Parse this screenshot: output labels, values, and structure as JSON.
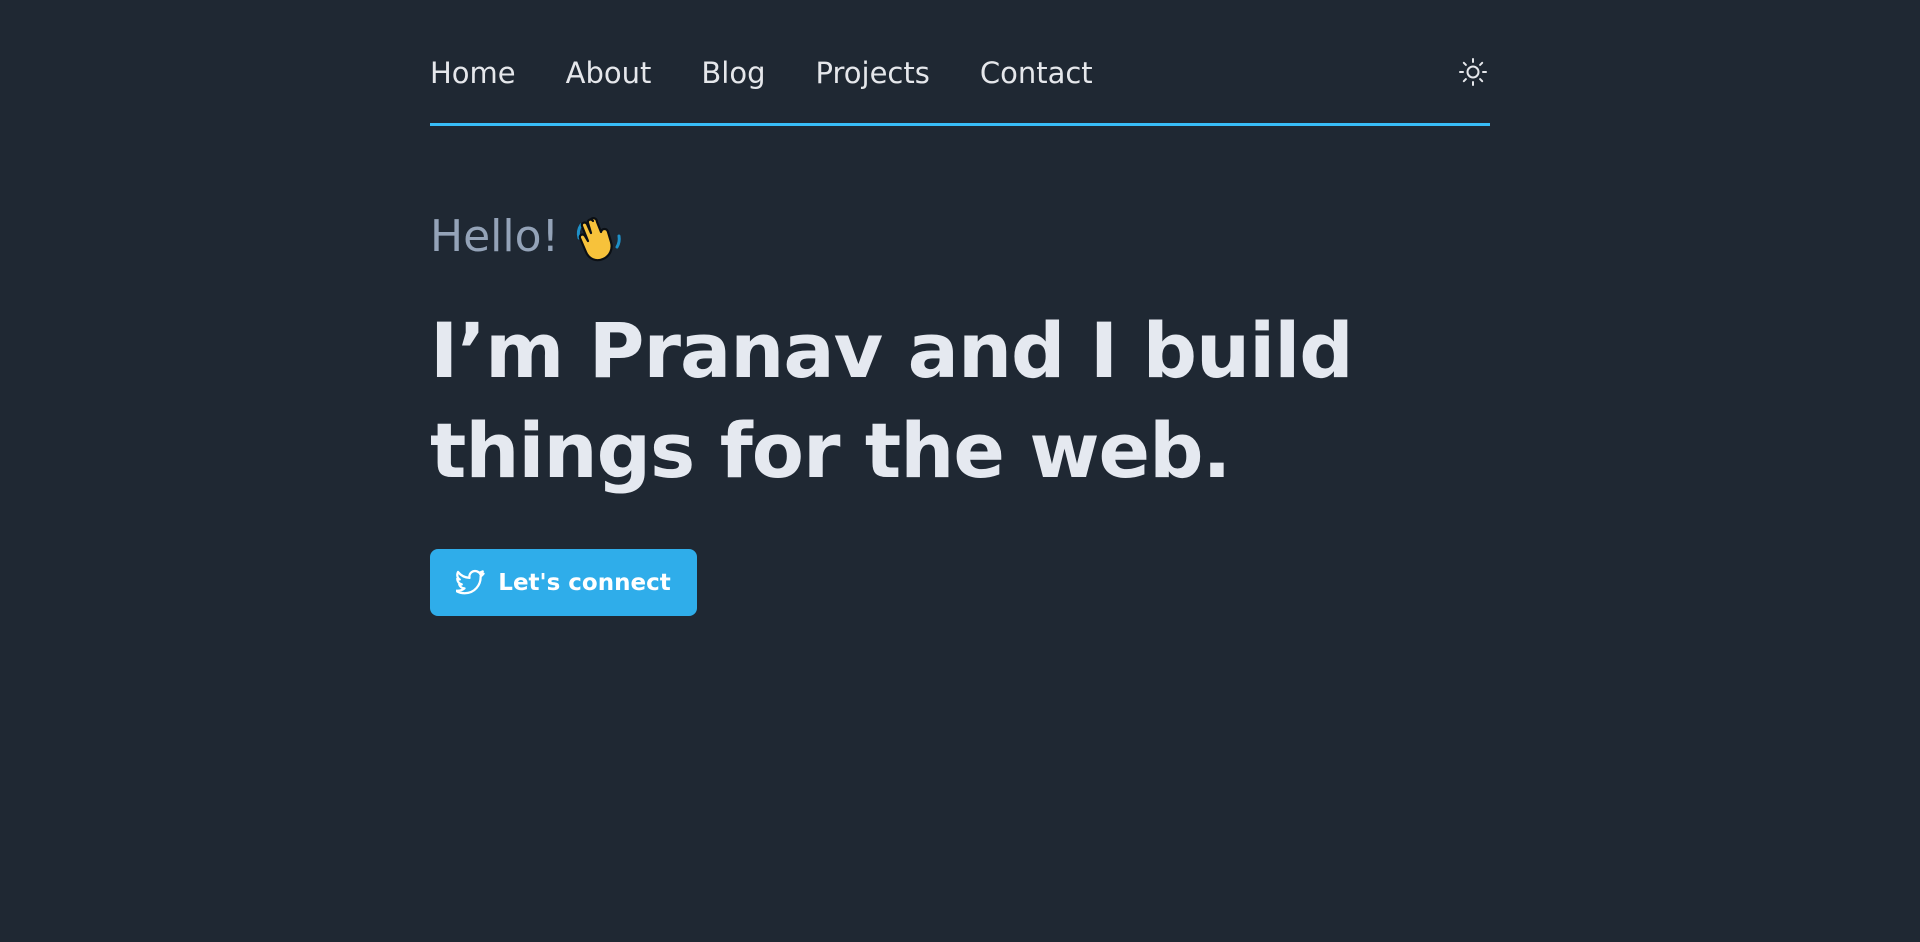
{
  "nav": {
    "links": [
      {
        "label": "Home"
      },
      {
        "label": "About"
      },
      {
        "label": "Blog"
      },
      {
        "label": "Projects"
      },
      {
        "label": "Contact"
      }
    ],
    "theme_toggle_icon": "sun-icon",
    "accent_color": "#38bdf8"
  },
  "hero": {
    "greeting": "Hello!",
    "greeting_icon": "waving-hand-icon",
    "headline": "I’m Pranav and I build things for the web.",
    "cta": {
      "label": "Let's connect",
      "icon": "twitter-icon",
      "color": "#2fadea"
    }
  },
  "colors": {
    "background": "#1f2833",
    "text_primary": "#e5e9f0",
    "text_muted": "#94a3b8"
  }
}
